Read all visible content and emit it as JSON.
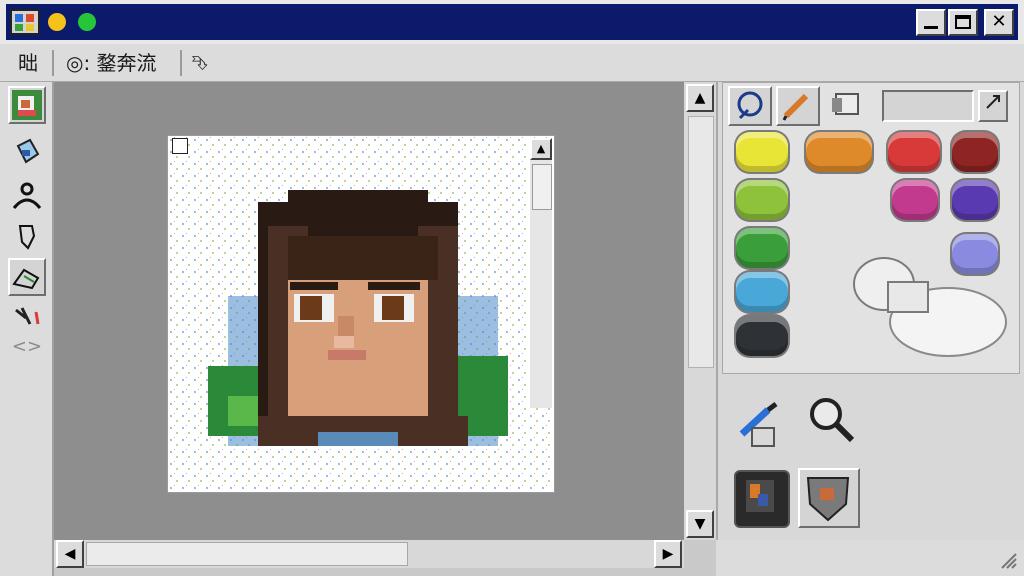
{
  "window": {
    "title": "",
    "controls": [
      "minimize",
      "maximize",
      "close"
    ],
    "close_glyph": "✕"
  },
  "menubar": {
    "items": [
      {
        "label": "昢"
      },
      {
        "label": "◎: 鍪奔流"
      },
      {
        "label": "⮷"
      }
    ]
  },
  "left_tools": [
    {
      "icon": "portrait-thumbnail-icon"
    },
    {
      "icon": "fill-bucket-icon"
    },
    {
      "icon": "user-select-icon"
    },
    {
      "icon": "hand-icon"
    },
    {
      "icon": "spray-icon"
    },
    {
      "icon": "dropper-icon"
    },
    {
      "icon": "code-brackets-icon"
    }
  ],
  "code_glyph": "<>",
  "panel_tabs": [
    {
      "icon": "color-picker-tab-icon"
    },
    {
      "icon": "pencil-tab-icon"
    },
    {
      "icon": "layers-tab-icon"
    }
  ],
  "palette": [
    {
      "name": "yellow",
      "color": "#e9e537"
    },
    {
      "name": "orange",
      "color": "#df8a2a"
    },
    {
      "name": "red",
      "color": "#d83a3a"
    },
    {
      "name": "dark-red",
      "color": "#8e2424"
    },
    {
      "name": "yellow-green",
      "color": "#8ec23a"
    },
    {
      "name": "magenta",
      "color": "#c23a8e"
    },
    {
      "name": "violet",
      "color": "#5a3ab0"
    },
    {
      "name": "green",
      "color": "#3a9e3a"
    },
    {
      "name": "lavender",
      "color": "#8a8ae0"
    },
    {
      "name": "sky-blue",
      "color": "#49a8d8"
    },
    {
      "name": "charcoal",
      "color": "#2e3236"
    }
  ],
  "tools_bottom": [
    {
      "icon": "eyedropper-icon"
    },
    {
      "icon": "magnifier-icon"
    },
    {
      "icon": "layer-thumbnail-icon"
    },
    {
      "icon": "shield-icon"
    }
  ],
  "scroll_glyphs": {
    "up": "▲",
    "down": "▼",
    "left": "◀",
    "right": "▶"
  },
  "canvas": {
    "subject": "pixel-art portrait"
  }
}
